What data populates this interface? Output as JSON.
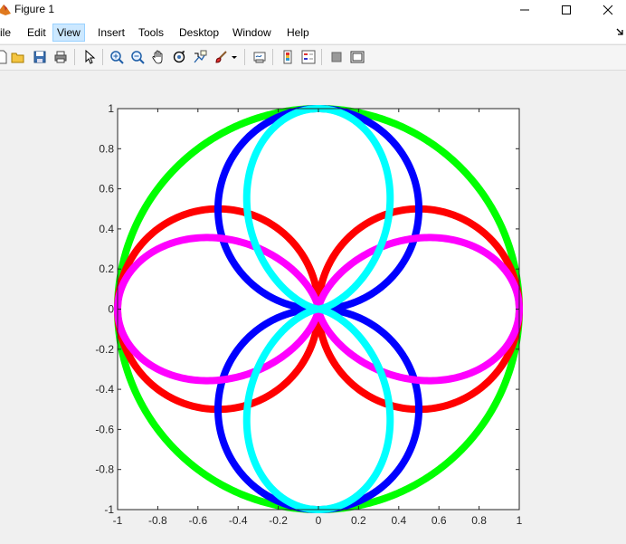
{
  "window": {
    "title": "Figure 1"
  },
  "menu": {
    "items": [
      {
        "label": "ile"
      },
      {
        "label": "Edit"
      },
      {
        "label": "View"
      },
      {
        "label": "Insert"
      },
      {
        "label": "Tools"
      },
      {
        "label": "Desktop"
      },
      {
        "label": "Window"
      },
      {
        "label": "Help"
      }
    ]
  },
  "toolbar": {
    "icons": [
      "new-figure-icon",
      "open-file-icon",
      "save-icon",
      "print-icon",
      "select-arrow-icon",
      "zoom-in-icon",
      "zoom-out-icon",
      "pan-hand-icon",
      "rotate-3d-icon",
      "data-cursor-icon",
      "brush-icon",
      "dropdown-arrow-icon",
      "link-plot-icon",
      "colorbar-icon",
      "legend-icon",
      "hide-plot-tools-icon",
      "show-plot-tools-icon"
    ]
  },
  "chart_data": {
    "type": "line",
    "xlim": [
      -1,
      1
    ],
    "ylim": [
      -1,
      1
    ],
    "grid": false,
    "x_ticks": [
      "-1",
      "-0.8",
      "-0.6",
      "-0.4",
      "-0.2",
      "0",
      "0.2",
      "0.4",
      "0.6",
      "0.8",
      "1"
    ],
    "y_ticks": [
      "-1",
      "-0.8",
      "-0.6",
      "-0.4",
      "-0.2",
      "0",
      "0.2",
      "0.4",
      "0.6",
      "0.8",
      "1"
    ],
    "series": [
      {
        "curve": "unit-circle",
        "color": "#00ff00"
      },
      {
        "curve": "four-lobe horizontal (cos2 lobes)",
        "color": "#ff0000"
      },
      {
        "curve": "two-lobe vertical (sin2 lobes)",
        "color": "#0000ff"
      },
      {
        "curve": "two-lobe horizontal narrow",
        "color": "#ff00ff"
      },
      {
        "curve": "two-lobe vertical narrow",
        "color": "#00ffff"
      }
    ]
  }
}
